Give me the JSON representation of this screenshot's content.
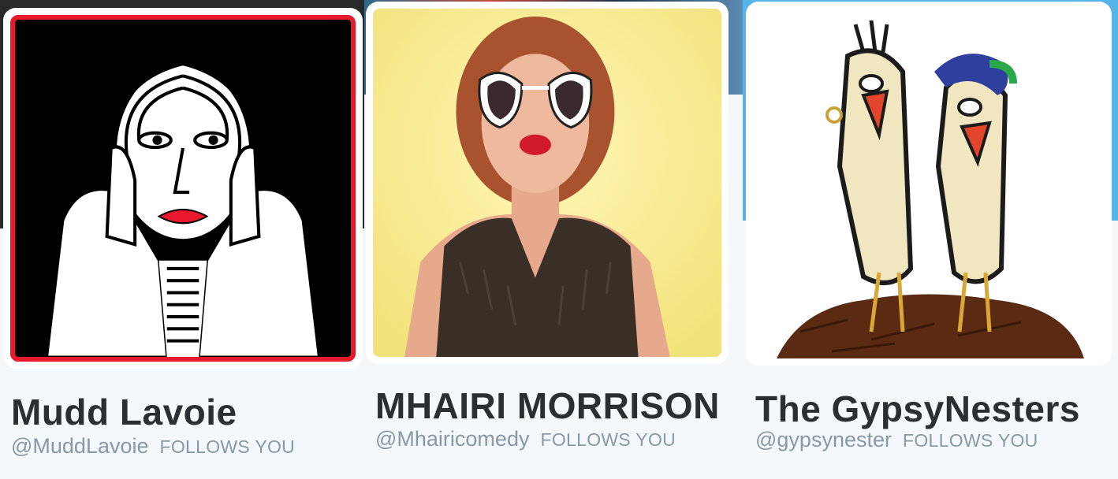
{
  "cards": [
    {
      "name": "Mudd Lavoie",
      "handle": "@MuddLavoie",
      "follows_label": "FOLLOWS YOU",
      "avatar_icon": "illustrated-face-avatar",
      "avatar_border_color": "#e8192c"
    },
    {
      "name": "MHAIRI MORRISON",
      "handle": "@Mhairicomedy",
      "follows_label": "FOLLOWS YOU",
      "avatar_icon": "photo-portrait-avatar"
    },
    {
      "name": "The GypsyNesters",
      "handle": "@gypsynester",
      "follows_label": "FOLLOWS YOU",
      "avatar_icon": "cartoon-birds-avatar"
    }
  ],
  "colors": {
    "name_text": "#292f33",
    "meta_text": "#8899a6",
    "background": "#f5f8fa"
  }
}
